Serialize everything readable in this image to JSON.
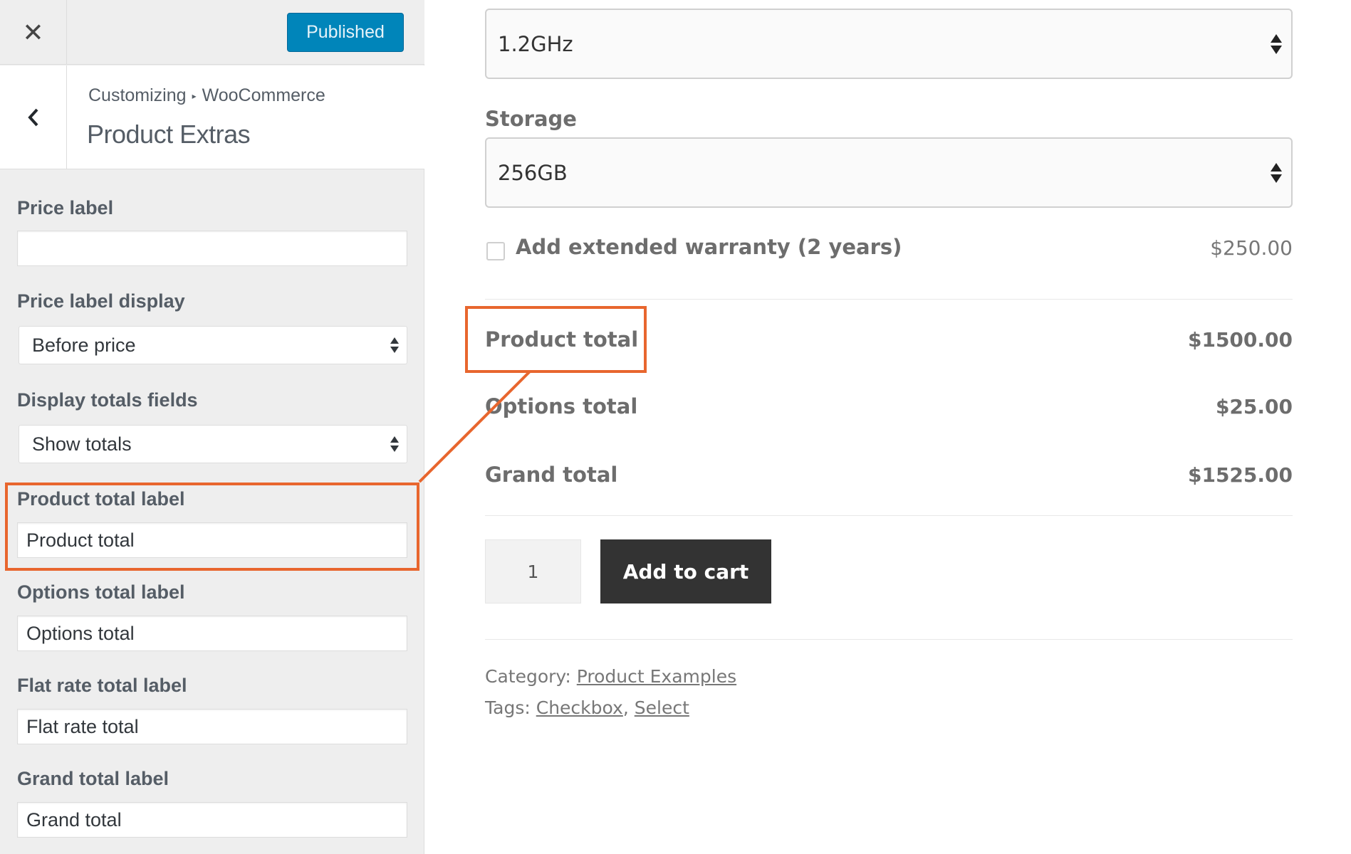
{
  "customizer": {
    "close_icon": "close-icon",
    "publish_label": "Published",
    "back_icon": "chevron-left-icon",
    "breadcrumb": {
      "root": "Customizing",
      "separator": "▸",
      "parent": "WooCommerce"
    },
    "section_title": "Product Extras",
    "controls": {
      "price_label": {
        "label": "Price label",
        "value": ""
      },
      "price_label_display": {
        "label": "Price label display",
        "selected": "Before price"
      },
      "display_totals_fields": {
        "label": "Display totals fields",
        "selected": "Show totals"
      },
      "product_total_label": {
        "label": "Product total label",
        "value": "Product total"
      },
      "options_total_label": {
        "label": "Options total label",
        "value": "Options total"
      },
      "flat_rate_total_label": {
        "label": "Flat rate total label",
        "value": "Flat rate total"
      },
      "grand_total_label": {
        "label": "Grand total label",
        "value": "Grand total"
      }
    },
    "publish_color": "#0085ba"
  },
  "product": {
    "processor_select": {
      "selected": "1.2GHz"
    },
    "storage": {
      "label": "Storage",
      "selected": "256GB"
    },
    "warranty": {
      "label": "Add extended warranty (2 years)",
      "price": "$250.00",
      "checked": false
    },
    "totals": {
      "product_total": {
        "label": "Product total",
        "value": "$1500.00"
      },
      "options_total": {
        "label": "Options total",
        "value": "$25.00"
      },
      "grand_total": {
        "label": "Grand total",
        "value": "$1525.00"
      }
    },
    "quantity": "1",
    "add_to_cart": "Add to cart",
    "category": {
      "label": "Category:",
      "link": "Product Examples"
    },
    "tags": {
      "label": "Tags:",
      "items": [
        "Checkbox",
        "Select"
      ],
      "separator": ","
    }
  },
  "highlight_color": "#e8662e"
}
